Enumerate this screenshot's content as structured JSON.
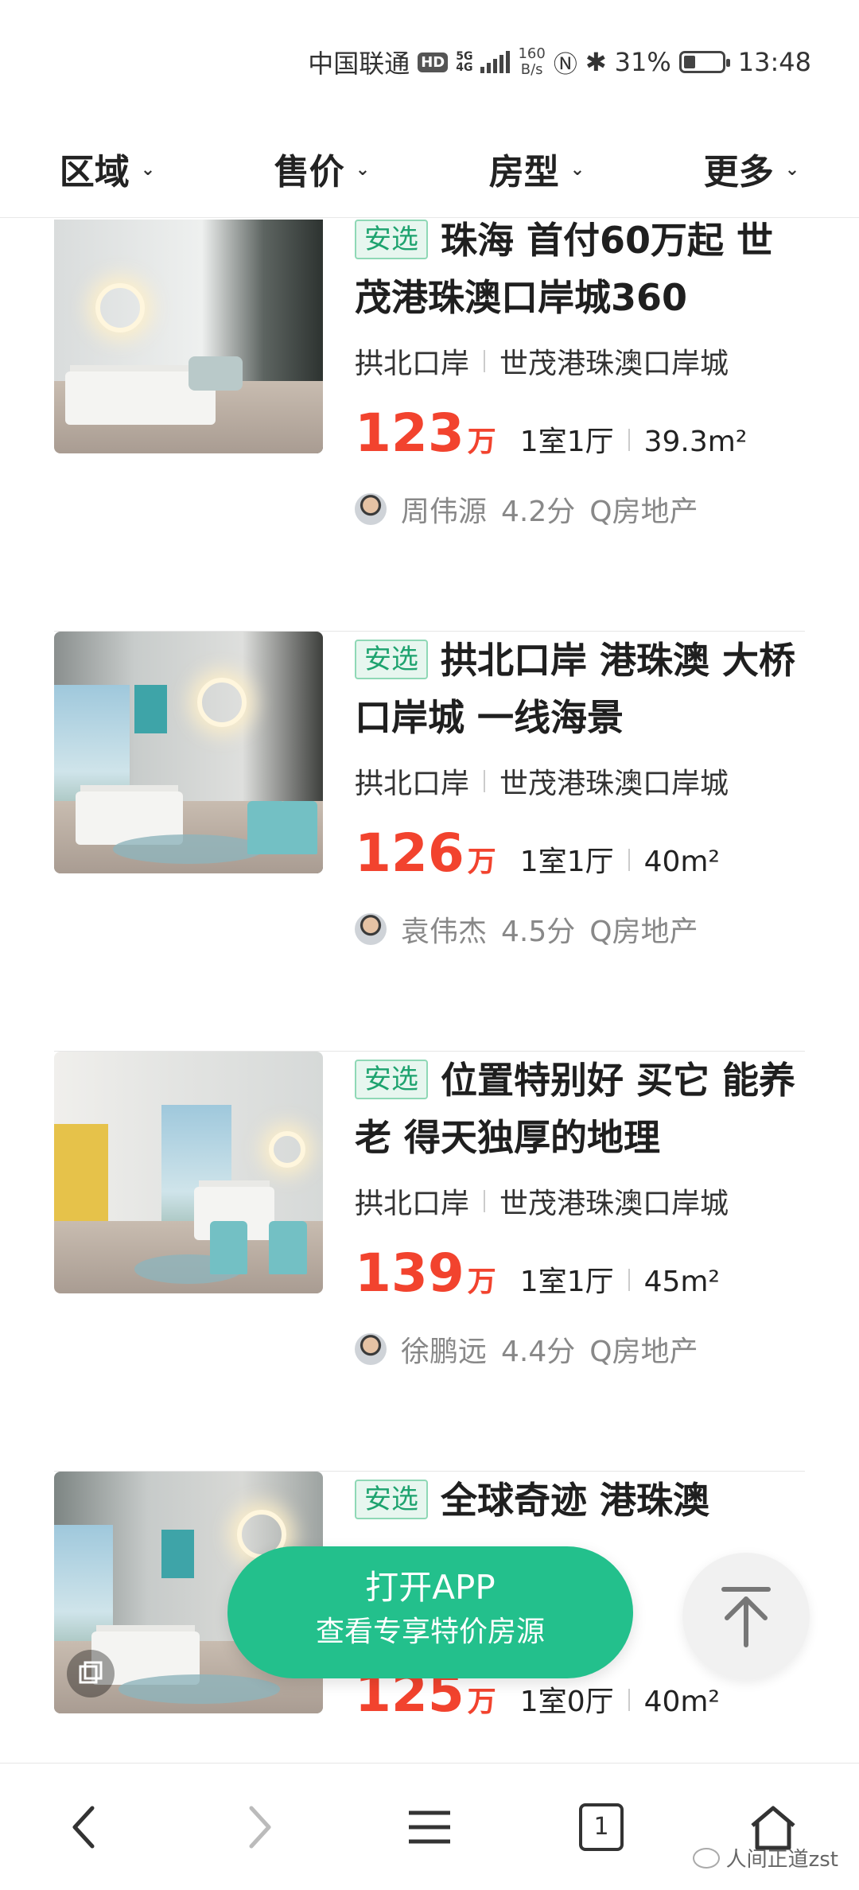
{
  "status": {
    "carrier": "中国联通",
    "hd": "HD",
    "network_top": "5G",
    "network_bottom": "4G",
    "speed_value": "160",
    "speed_unit": "B/s",
    "battery": "31%",
    "battery_level": 0.31,
    "time": "13:48"
  },
  "filters": [
    {
      "label": "区域"
    },
    {
      "label": "售价"
    },
    {
      "label": "房型"
    },
    {
      "label": "更多"
    }
  ],
  "listings": [
    {
      "tag": "安选",
      "title": "珠海 首付60万起 世茂港珠澳口岸城360",
      "district": "拱北口岸",
      "community": "世茂港珠澳口岸城",
      "price": "123",
      "price_unit": "万",
      "layout": "1室1厅",
      "area": "39.3m²",
      "agent": "周伟源",
      "score": "4.2分",
      "company": "Q房地产"
    },
    {
      "tag": "安选",
      "title": "拱北口岸 港珠澳 大桥口岸城 一线海景",
      "district": "拱北口岸",
      "community": "世茂港珠澳口岸城",
      "price": "126",
      "price_unit": "万",
      "layout": "1室1厅",
      "area": "40m²",
      "agent": "袁伟杰",
      "score": "4.5分",
      "company": "Q房地产"
    },
    {
      "tag": "安选",
      "title": "位置特别好 买它 能养老 得天独厚的地理",
      "district": "拱北口岸",
      "community": "世茂港珠澳口岸城",
      "price": "139",
      "price_unit": "万",
      "layout": "1室1厅",
      "area": "45m²",
      "agent": "徐鹏远",
      "score": "4.4分",
      "company": "Q房地产"
    },
    {
      "tag": "安选",
      "title": "全球奇迹 港珠澳",
      "district": "",
      "community": "",
      "price": "125",
      "price_unit": "万",
      "layout": "1室0厅",
      "area": "40m²",
      "agent": "",
      "score": "",
      "company": ""
    }
  ],
  "open_app": {
    "line1": "打开APP",
    "line2": "查看专享特价房源"
  },
  "browser": {
    "tab_count": "1"
  },
  "watermark": "人间正道zst"
}
